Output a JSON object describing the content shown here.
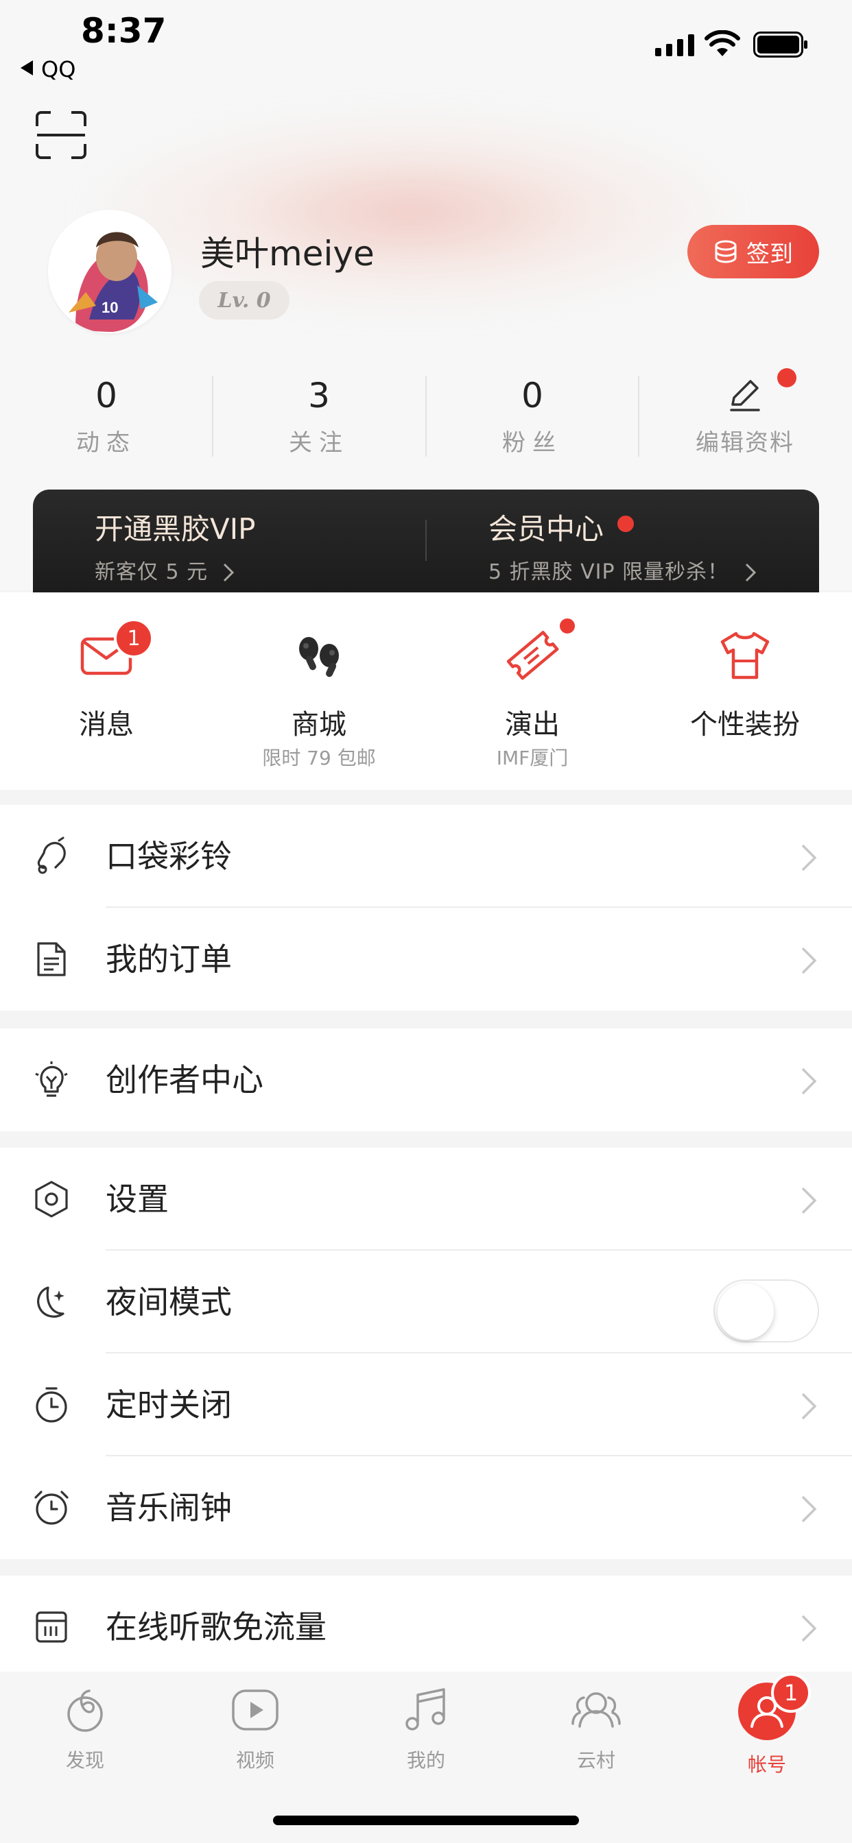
{
  "status_bar": {
    "time": "8:37",
    "back_label": "QQ"
  },
  "profile": {
    "username": "美叶meiye",
    "level": "Lv. 0",
    "signin_label": "签到"
  },
  "stats": [
    {
      "num": "0",
      "label": "动态"
    },
    {
      "num": "3",
      "label": "关注"
    },
    {
      "num": "0",
      "label": "粉丝"
    },
    {
      "label": "编辑资料"
    }
  ],
  "vip": {
    "left_title": "开通黑胶VIP",
    "left_sub": "新客仅 5 元",
    "right_title": "会员中心",
    "right_sub": "5 折黑胶 VIP 限量秒杀！"
  },
  "quick_icons": [
    {
      "title": "消息",
      "sub": "",
      "badge": "1"
    },
    {
      "title": "商城",
      "sub": "限时 79 包邮"
    },
    {
      "title": "演出",
      "sub": "IMF厦门"
    },
    {
      "title": "个性装扮",
      "sub": ""
    }
  ],
  "menu_group_1": [
    "口袋彩铃",
    "我的订单"
  ],
  "menu_group_2": [
    "创作者中心"
  ],
  "menu_group_3": [
    "设置",
    "夜间模式",
    "定时关闭",
    "音乐闹钟"
  ],
  "menu_group_4": [
    "在线听歌免流量"
  ],
  "night_mode_on": false,
  "tabbar": {
    "items": [
      "发现",
      "视频",
      "我的",
      "云村",
      "帐号"
    ],
    "active": "帐号",
    "account_badge": "1"
  },
  "colors": {
    "accent": "#ea3b33",
    "vip_bg": "#1c1c1c",
    "vip_text": "#f3e5d8"
  }
}
